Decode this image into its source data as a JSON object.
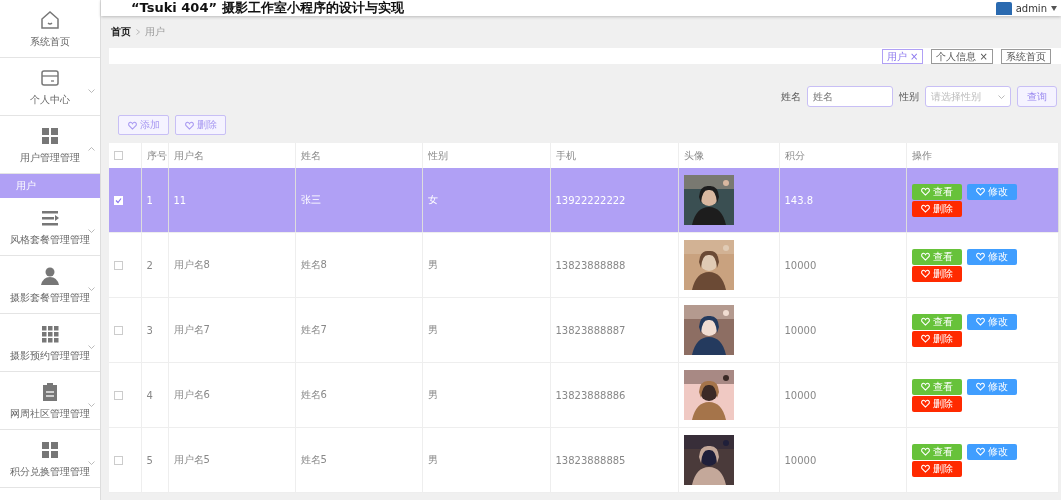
{
  "header": {
    "title": "“Tsuki 404” 摄影工作室小程序的设计与实现",
    "user": "admin"
  },
  "sidebar": {
    "items": [
      {
        "label": "系统首页",
        "kind": "home"
      },
      {
        "label": "个人中心",
        "kind": "card",
        "expanded": false
      },
      {
        "label": "用户管理管理",
        "kind": "grid4",
        "expanded": true,
        "children": [
          {
            "label": "用户",
            "selected": true
          }
        ]
      },
      {
        "label": "风格套餐管理管理",
        "kind": "lines",
        "expanded": false
      },
      {
        "label": "摄影套餐管理管理",
        "kind": "person",
        "expanded": false
      },
      {
        "label": "摄影预约管理管理",
        "kind": "grid9",
        "expanded": false
      },
      {
        "label": "网周社区管理管理",
        "kind": "clipboard",
        "expanded": false
      },
      {
        "label": "积分兑换管理管理",
        "kind": "grid4",
        "expanded": false
      }
    ]
  },
  "breadcrumb": [
    "首页",
    "用户"
  ],
  "tabs": [
    {
      "label": "用户 ×",
      "selected": true
    },
    {
      "label": "个人信息 ×",
      "selected": false
    },
    {
      "label": "系统首页",
      "selected": false
    }
  ],
  "search": {
    "name_label": "姓名",
    "name_placeholder": "姓名",
    "gender_label": "性别",
    "gender_placeholder": "请选择性别",
    "button": "查询"
  },
  "actions": [
    "添加",
    "删除"
  ],
  "table": {
    "select_all_checked": false,
    "columns": [
      "序号",
      "用户名",
      "姓名",
      "性别",
      "手机",
      "头像",
      "积分",
      "操作"
    ],
    "rows": [
      {
        "index": "1",
        "username": "11",
        "name": "张三",
        "gender": "女",
        "phone": "13922222222",
        "points": "143.8",
        "selected": true,
        "checked": true,
        "buttons": [
          {
            "label": "查看",
            "kind": "view"
          },
          {
            "label": "修改",
            "kind": "edit"
          },
          {
            "label": "删除",
            "kind": "delete"
          }
        ]
      },
      {
        "index": "2",
        "username": "用户名8",
        "name": "姓名8",
        "gender": "男",
        "phone": "13823888888",
        "points": "10000",
        "selected": false,
        "checked": false,
        "buttons": [
          {
            "label": "查看",
            "kind": "view"
          },
          {
            "label": "修改",
            "kind": "edit"
          },
          {
            "label": "删除",
            "kind": "delete"
          }
        ]
      },
      {
        "index": "3",
        "username": "用户名7",
        "name": "姓名7",
        "gender": "男",
        "phone": "13823888887",
        "points": "10000",
        "selected": false,
        "checked": false,
        "buttons": [
          {
            "label": "查看",
            "kind": "view"
          },
          {
            "label": "修改",
            "kind": "edit"
          },
          {
            "label": "删除",
            "kind": "delete"
          }
        ]
      },
      {
        "index": "4",
        "username": "用户名6",
        "name": "姓名6",
        "gender": "男",
        "phone": "13823888886",
        "points": "10000",
        "selected": false,
        "checked": false,
        "buttons": [
          {
            "label": "查看",
            "kind": "view"
          },
          {
            "label": "修改",
            "kind": "edit"
          },
          {
            "label": "删除",
            "kind": "delete"
          }
        ]
      },
      {
        "index": "5",
        "username": "用户名5",
        "name": "姓名5",
        "gender": "男",
        "phone": "13823888885",
        "points": "10000",
        "selected": false,
        "checked": false,
        "buttons": [
          {
            "label": "查看",
            "kind": "view"
          },
          {
            "label": "修改",
            "kind": "edit"
          },
          {
            "label": "删除",
            "kind": "delete"
          }
        ]
      }
    ]
  }
}
